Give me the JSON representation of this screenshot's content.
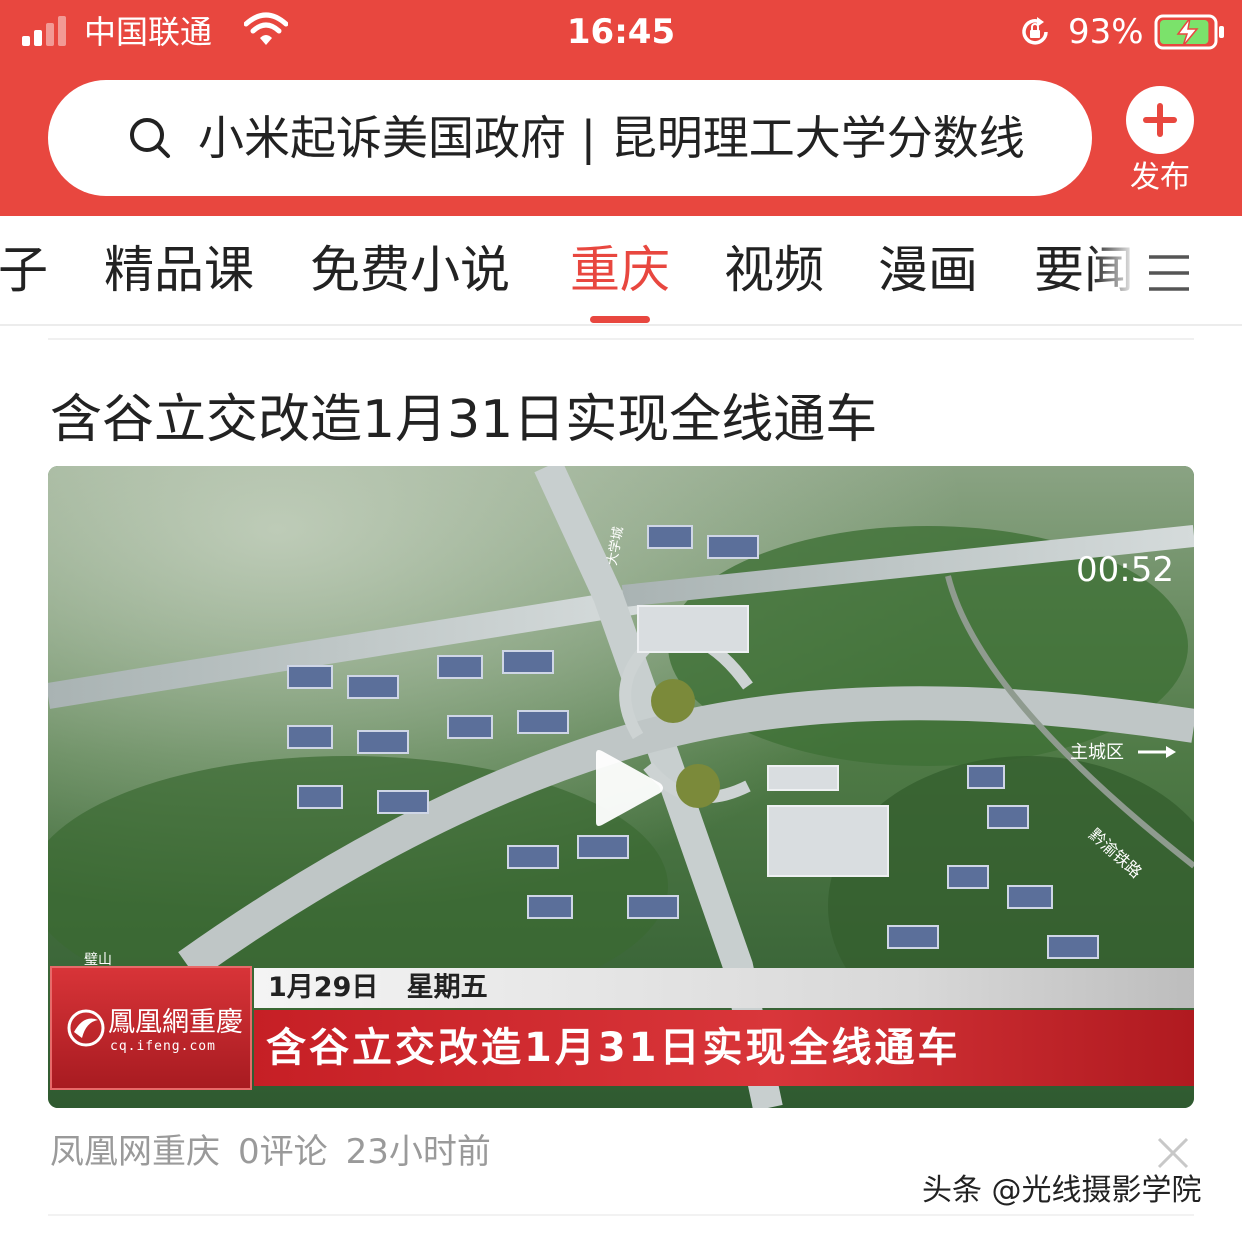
{
  "status_bar": {
    "carrier": "中国联通",
    "time": "16:45",
    "battery_percent": "93%",
    "battery_level": 0.93,
    "icons": [
      "signal-icon",
      "wifi-icon",
      "rotation-lock-icon",
      "battery-charging-icon"
    ]
  },
  "search": {
    "query": "小米起诉美国政府 | 昆明理工大学分数线",
    "icon": "search-icon"
  },
  "publish": {
    "label": "发布",
    "icon": "plus-icon"
  },
  "tabs": [
    {
      "label": "子",
      "active": false
    },
    {
      "label": "精品课",
      "active": false
    },
    {
      "label": "免费小说",
      "active": false
    },
    {
      "label": "重庆",
      "active": true
    },
    {
      "label": "视频",
      "active": false
    },
    {
      "label": "漫画",
      "active": false
    },
    {
      "label": "要闻",
      "active": false
    }
  ],
  "article": {
    "title": "含谷立交改造1月31日实现全线通车",
    "video": {
      "channel_logo": "鳳凰網重慶",
      "channel_url": "cq.ifeng.com",
      "date": "1月29日",
      "weekday": "星期五",
      "caption": "含谷立交改造1月31日实现全线通车",
      "duration": "00:52",
      "map_labels": {
        "top_road": "大学城",
        "main_city": "主城区",
        "railway": "黔渝铁路",
        "bishan": "璧山"
      }
    },
    "source": "凤凰网重庆",
    "comments": "0评论",
    "time_ago": "23小时前"
  },
  "watermark": "头条 @光线摄影学院",
  "colors": {
    "brand_red": "#e8473f",
    "tab_text": "#222222",
    "meta_gray": "#9a9a9a"
  }
}
